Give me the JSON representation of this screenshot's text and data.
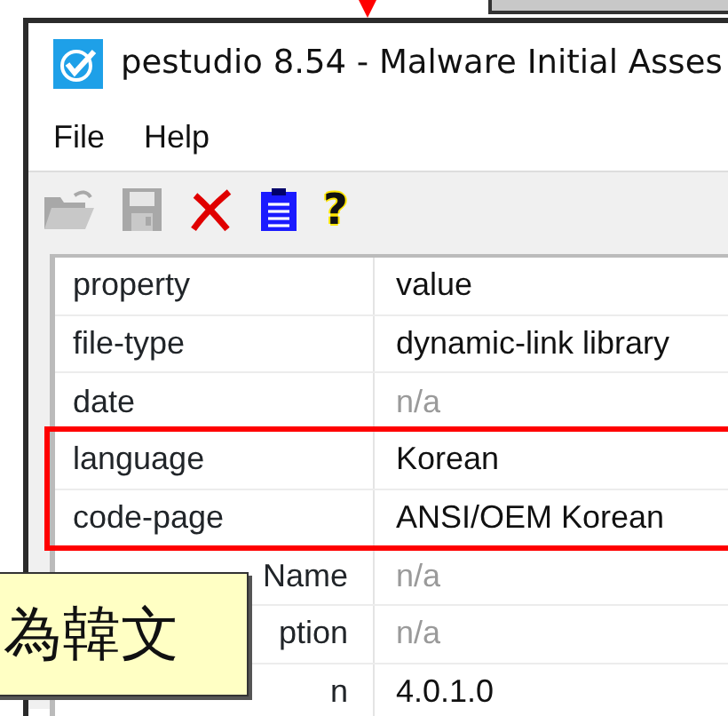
{
  "window": {
    "title": "pestudio 8.54 - Malware Initial Asses"
  },
  "menu": [
    {
      "label": "File"
    },
    {
      "label": "Help"
    }
  ],
  "toolbar": [
    {
      "kind": "open",
      "disabled": true
    },
    {
      "kind": "save",
      "disabled": true
    },
    {
      "kind": "delete",
      "disabled": false
    },
    {
      "kind": "clipboard",
      "disabled": false
    },
    {
      "kind": "help",
      "glyph": "?",
      "disabled": false
    }
  ],
  "table": {
    "columns": [
      "property",
      "value"
    ],
    "rows": [
      {
        "property": "file-type",
        "value": "dynamic-link library",
        "muted": false,
        "highlighted": false,
        "cut": false
      },
      {
        "property": "date",
        "value": "n/a",
        "muted": true,
        "highlighted": false,
        "cut": false
      },
      {
        "property": "language",
        "value": "Korean",
        "muted": false,
        "highlighted": true,
        "cut": false
      },
      {
        "property": "code-page",
        "value": "ANSI/OEM Korean",
        "muted": false,
        "highlighted": true,
        "cut": false
      },
      {
        "property": "Name",
        "value": "n/a",
        "muted": true,
        "highlighted": false,
        "cut": true
      },
      {
        "property": "ption",
        "value": "n/a",
        "muted": true,
        "highlighted": false,
        "cut": true
      },
      {
        "property": "n",
        "value": "4.0.1.0",
        "muted": false,
        "highlighted": false,
        "cut": true
      }
    ]
  },
  "callout": {
    "text": "為韓文"
  }
}
